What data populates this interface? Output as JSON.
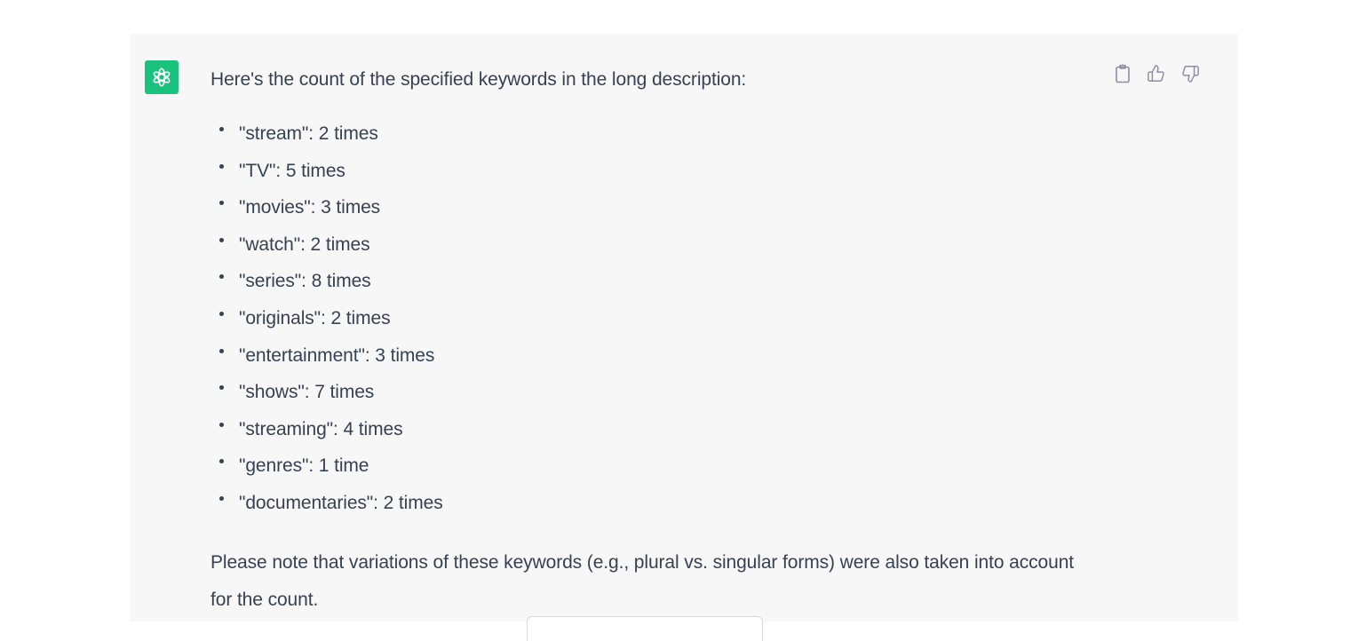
{
  "message": {
    "intro": "Here's the count of the specified keywords in the long description:",
    "keywords": [
      {
        "text": "\"stream\": 2 times"
      },
      {
        "text": "\"TV\": 5 times"
      },
      {
        "text": "\"movies\": 3 times"
      },
      {
        "text": "\"watch\": 2 times"
      },
      {
        "text": "\"series\": 8 times"
      },
      {
        "text": "\"originals\": 2 times"
      },
      {
        "text": "\"entertainment\": 3 times"
      },
      {
        "text": "\"shows\": 7 times"
      },
      {
        "text": "\"streaming\": 4 times"
      },
      {
        "text": "\"genres\": 1 time"
      },
      {
        "text": "\"documentaries\": 2 times"
      }
    ],
    "note": "Please note that variations of these keywords (e.g., plural vs. singular forms) were also taken into account for the count."
  },
  "actions": {
    "copy_icon": "clipboard-icon",
    "like_icon": "thumbs-up-icon",
    "dislike_icon": "thumbs-down-icon"
  },
  "colors": {
    "avatar_bg": "#19c37d",
    "message_bg": "#f7f7f8",
    "text": "#374151",
    "icon": "#8e8ea0"
  }
}
